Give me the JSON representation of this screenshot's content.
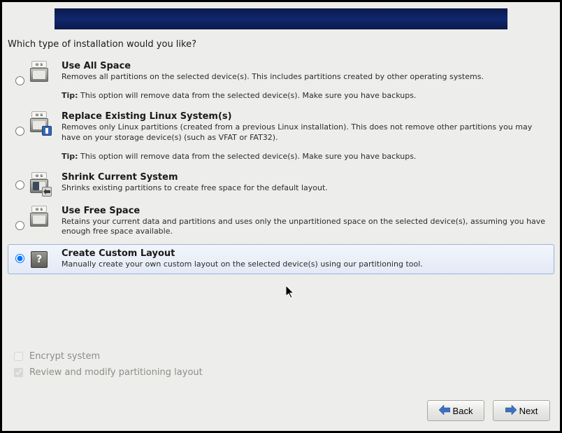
{
  "question": "Which type of installation would you like?",
  "options": [
    {
      "id": "use-all-space",
      "title": "Use All Space",
      "desc": "Removes all partitions on the selected device(s).  This includes partitions created by other operating systems.",
      "tip_label": "Tip:",
      "tip": "This option will remove data from the selected device(s).  Make sure you have backups.",
      "icon": "disk-all",
      "selected": false
    },
    {
      "id": "replace-linux",
      "title": "Replace Existing Linux System(s)",
      "desc": "Removes only Linux partitions (created from a previous Linux installation).  This does not remove other partitions you may have on your storage device(s) (such as VFAT or FAT32).",
      "tip_label": "Tip:",
      "tip": "This option will remove data from the selected device(s).  Make sure you have backups.",
      "icon": "disk-replace",
      "selected": false
    },
    {
      "id": "shrink-current",
      "title": "Shrink Current System",
      "desc": "Shrinks existing partitions to create free space for the default layout.",
      "tip_label": "",
      "tip": "",
      "icon": "disk-shrink",
      "selected": false
    },
    {
      "id": "use-free-space",
      "title": "Use Free Space",
      "desc": "Retains your current data and partitions and uses only the unpartitioned space on the selected device(s), assuming you have enough free space available.",
      "tip_label": "",
      "tip": "",
      "icon": "disk-free",
      "selected": false
    },
    {
      "id": "custom-layout",
      "title": "Create Custom Layout",
      "desc": "Manually create your own custom layout on the selected device(s) using our partitioning tool.",
      "tip_label": "",
      "tip": "",
      "icon": "question",
      "selected": true
    }
  ],
  "checks": {
    "encrypt_label": "Encrypt system",
    "encrypt_checked": false,
    "review_label": "Review and modify partitioning layout",
    "review_checked": true
  },
  "buttons": {
    "back": "Back",
    "next": "Next"
  },
  "os_tab": "o s"
}
